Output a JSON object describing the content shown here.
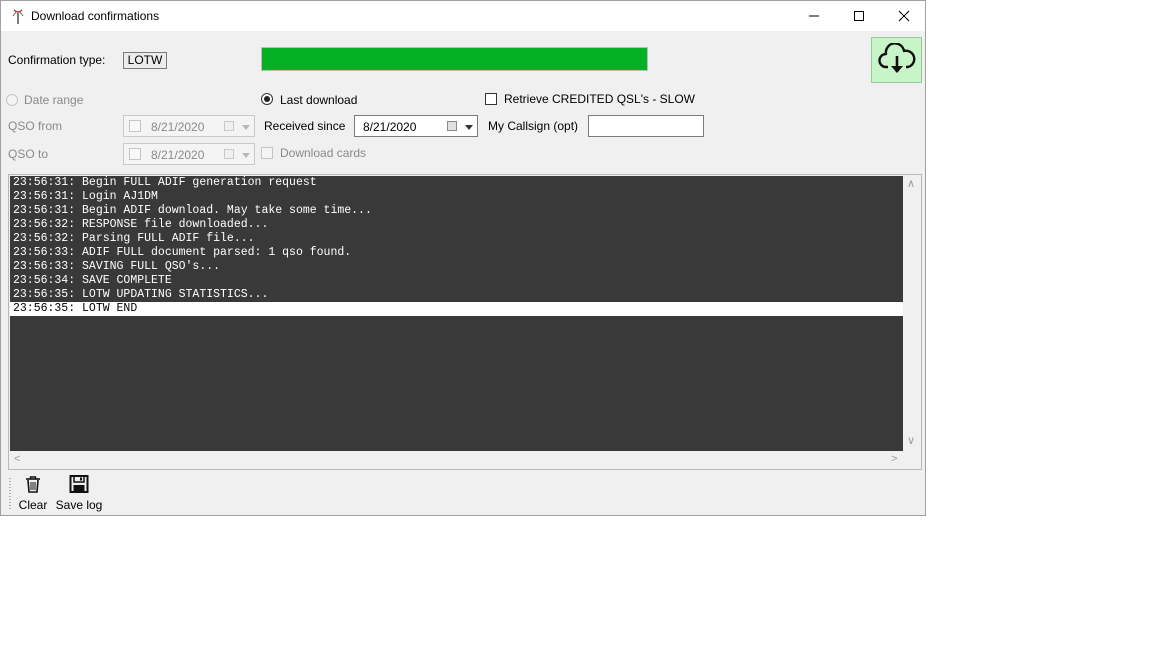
{
  "window": {
    "title": "Download confirmations",
    "icon": "antenna-icon"
  },
  "header": {
    "confirmation_type_label": "Confirmation type:",
    "confirmation_type_value": "LOTW",
    "progress_percent": 100,
    "progress_color": "#06b025",
    "download_button_icon": "cloud-download-icon",
    "download_button_bg": "#c8f5c8"
  },
  "options": {
    "date_range_label": "Date range",
    "date_range_selected": false,
    "last_download_label": "Last download",
    "last_download_selected": true,
    "retrieve_credited_label": "Retrieve CREDITED QSL's - SLOW",
    "retrieve_credited_checked": false,
    "qso_from_label": "QSO from",
    "qso_from_value": "8/21/2020",
    "qso_to_label": "QSO to",
    "qso_to_value": "8/21/2020",
    "received_since_label": "Received since",
    "received_since_value": "8/21/2020",
    "my_callsign_label": "My Callsign (opt)",
    "my_callsign_value": "",
    "download_cards_label": "Download cards",
    "download_cards_checked": false
  },
  "log": {
    "lines": [
      "23:56:31: Begin FULL ADIF generation request",
      "23:56:31: Login AJ1DM",
      "23:56:31: Begin ADIF download. May take some time...",
      "23:56:32: RESPONSE file downloaded...",
      "23:56:32: Parsing FULL ADIF file...",
      "23:56:33: ADIF FULL document parsed: 1 qso found.",
      "23:56:33: SAVING FULL QSO's...",
      "23:56:34: SAVE COMPLETE",
      "23:56:35: LOTW UPDATING STATISTICS...",
      "23:56:35: LOTW END"
    ],
    "selected_index": 9,
    "background": "#393939"
  },
  "toolbar": {
    "clear_label": "Clear",
    "clear_icon": "trash-icon",
    "save_log_label": "Save log",
    "save_log_icon": "floppy-disk-icon"
  }
}
